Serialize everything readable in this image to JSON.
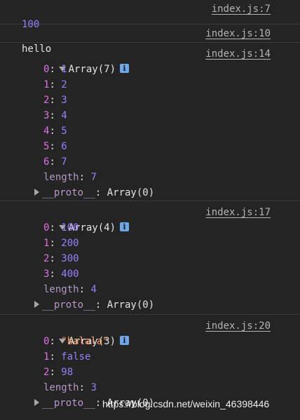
{
  "messages": [
    {
      "value": "100",
      "source": "index.js:7"
    },
    {
      "value": "hello",
      "source": "index.js:10"
    }
  ],
  "arrays": [
    {
      "header": "Array(7)",
      "source": "index.js:14",
      "items": [
        {
          "index": "0",
          "value": "1",
          "type": "number"
        },
        {
          "index": "1",
          "value": "2",
          "type": "number"
        },
        {
          "index": "2",
          "value": "3",
          "type": "number"
        },
        {
          "index": "3",
          "value": "4",
          "type": "number"
        },
        {
          "index": "4",
          "value": "5",
          "type": "number"
        },
        {
          "index": "5",
          "value": "6",
          "type": "number"
        },
        {
          "index": "6",
          "value": "7",
          "type": "number"
        }
      ],
      "length_label": "length",
      "length_value": "7",
      "proto_label": "__proto__",
      "proto_value": "Array(0)"
    },
    {
      "header": "Array(4)",
      "source": "index.js:17",
      "items": [
        {
          "index": "0",
          "value": "100",
          "type": "number"
        },
        {
          "index": "1",
          "value": "200",
          "type": "number"
        },
        {
          "index": "2",
          "value": "300",
          "type": "number"
        },
        {
          "index": "3",
          "value": "400",
          "type": "number"
        }
      ],
      "length_label": "length",
      "length_value": "4",
      "proto_label": "__proto__",
      "proto_value": "Array(0)"
    },
    {
      "header": "Array(3)",
      "source": "index.js:20",
      "items": [
        {
          "index": "0",
          "value": "\"balala\"",
          "type": "string"
        },
        {
          "index": "1",
          "value": "false",
          "type": "boolean"
        },
        {
          "index": "2",
          "value": "98",
          "type": "number"
        }
      ],
      "length_label": "length",
      "length_value": "3",
      "proto_label": "__proto__",
      "proto_value": "Array(0)"
    }
  ],
  "info_icon_glyph": "i",
  "watermark": "https://blog.csdn.net/weixin_46398446",
  "colors": {
    "background": "#242424",
    "number": "#9980ff",
    "key": "#e36eec",
    "string": "#f29766",
    "dim_key": "#b29ac9",
    "link": "#b4b4b4",
    "info_icon": "#6fa6e8"
  }
}
